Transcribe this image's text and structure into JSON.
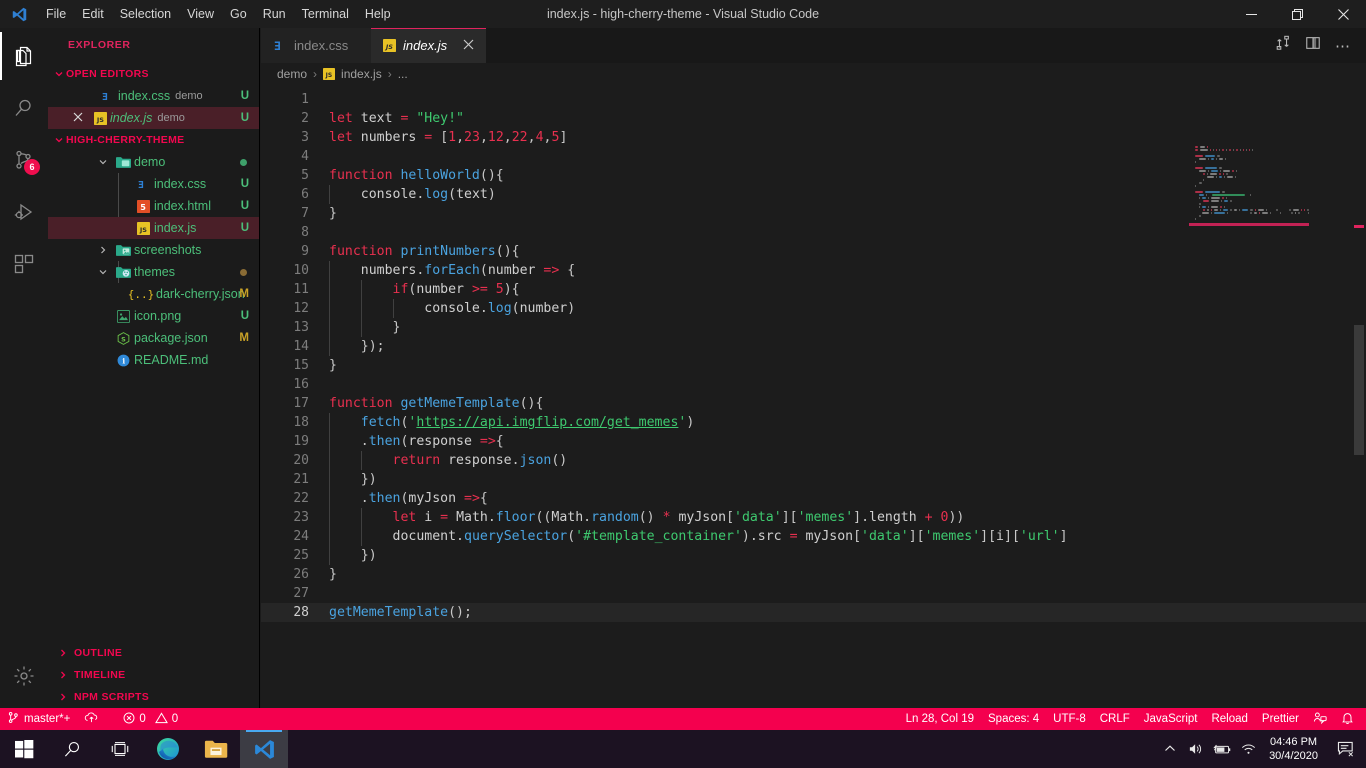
{
  "window": {
    "title": "index.js - high-cherry-theme - Visual Studio Code",
    "minimize_label": "Minimize",
    "maximize_label": "Restore",
    "close_label": "Close"
  },
  "menu": [
    "File",
    "Edit",
    "Selection",
    "View",
    "Go",
    "Run",
    "Terminal",
    "Help"
  ],
  "activitybar": {
    "items": [
      {
        "name": "explorer",
        "icon": "files-icon",
        "active": true,
        "badge": ""
      },
      {
        "name": "search",
        "icon": "search-icon",
        "active": false,
        "badge": ""
      },
      {
        "name": "source-control",
        "icon": "source-control-icon",
        "active": false,
        "badge": "6"
      },
      {
        "name": "run-debug",
        "icon": "run-debug-icon",
        "active": false,
        "badge": ""
      },
      {
        "name": "extensions",
        "icon": "extensions-icon",
        "active": false,
        "badge": ""
      }
    ],
    "settings_icon": "gear-icon"
  },
  "sidebar": {
    "title": "EXPLORER",
    "open_editors": {
      "label": "OPEN EDITORS",
      "items": [
        {
          "name": "index.css",
          "sub": "demo",
          "status": "U",
          "icon": "css-icon",
          "selected": false,
          "closable": false,
          "italic": false
        },
        {
          "name": "index.js",
          "sub": "demo",
          "status": "U",
          "icon": "js-icon",
          "selected": true,
          "closable": true,
          "italic": true
        }
      ]
    },
    "project": {
      "label": "HIGH-CHERRY-THEME",
      "items": [
        {
          "name": "demo",
          "type": "folder",
          "expanded": true,
          "depth": 1,
          "icon": "folder-demo-icon",
          "status": "",
          "dot": "#3ea06a",
          "selected": false
        },
        {
          "name": "index.css",
          "type": "file",
          "depth": 2,
          "icon": "css-icon",
          "status": "U",
          "selected": false
        },
        {
          "name": "index.html",
          "type": "file",
          "depth": 2,
          "icon": "html-icon",
          "status": "U",
          "selected": false
        },
        {
          "name": "index.js",
          "type": "file",
          "depth": 2,
          "icon": "js-icon",
          "status": "U",
          "selected": true
        },
        {
          "name": "screenshots",
          "type": "folder",
          "expanded": false,
          "depth": 1,
          "icon": "folder-images-icon",
          "status": "",
          "selected": false
        },
        {
          "name": "themes",
          "type": "folder",
          "expanded": true,
          "depth": 1,
          "icon": "folder-theme-icon",
          "status": "",
          "dot": "#9a7b3f",
          "selected": false
        },
        {
          "name": "dark-cherry.json",
          "type": "file",
          "depth": 2,
          "icon": "json-icon",
          "status": "M",
          "selected": false
        },
        {
          "name": "icon.png",
          "type": "file",
          "depth": 1,
          "icon": "image-icon",
          "status": "U",
          "selected": false
        },
        {
          "name": "package.json",
          "type": "file",
          "depth": 1,
          "icon": "nodejs-icon",
          "status": "M",
          "selected": false
        },
        {
          "name": "README.md",
          "type": "file",
          "depth": 1,
          "icon": "info-icon",
          "status": "",
          "selected": false
        }
      ]
    },
    "bottom_sections": [
      "OUTLINE",
      "TIMELINE",
      "NPM SCRIPTS"
    ]
  },
  "editor": {
    "tabs": [
      {
        "label": "index.css",
        "icon": "css-icon",
        "active": false,
        "closable": false
      },
      {
        "label": "index.js",
        "icon": "js-icon",
        "active": true,
        "closable": true
      }
    ],
    "tab_actions": [
      "split-editor-icon",
      "more-actions-icon"
    ],
    "title_actions": [
      "compare-changes-icon"
    ],
    "breadcrumb": [
      "demo",
      "index.js",
      "..."
    ],
    "breadcrumb_icon": "js-icon",
    "current_line": 28,
    "lines": [
      {
        "n": 1,
        "tokens": []
      },
      {
        "n": 2,
        "tokens": [
          [
            "kw",
            "let"
          ],
          [
            "var",
            " text "
          ],
          [
            "op",
            "="
          ],
          [
            "str",
            " \"Hey!\""
          ]
        ]
      },
      {
        "n": 3,
        "tokens": [
          [
            "kw",
            "let"
          ],
          [
            "var",
            " numbers "
          ],
          [
            "op",
            "="
          ],
          [
            "punc",
            " ["
          ],
          [
            "num",
            "1"
          ],
          [
            "punc",
            ","
          ],
          [
            "num",
            "23"
          ],
          [
            "punc",
            ","
          ],
          [
            "num",
            "12"
          ],
          [
            "punc",
            ","
          ],
          [
            "num",
            "22"
          ],
          [
            "punc",
            ","
          ],
          [
            "num",
            "4"
          ],
          [
            "punc",
            ","
          ],
          [
            "num",
            "5"
          ],
          [
            "punc",
            "]"
          ]
        ]
      },
      {
        "n": 4,
        "tokens": []
      },
      {
        "n": 5,
        "tokens": [
          [
            "kw",
            "function"
          ],
          [
            "fn",
            " helloWorld"
          ],
          [
            "punc",
            "(){"
          ]
        ]
      },
      {
        "n": 6,
        "tokens": [
          [
            "var",
            "    console"
          ],
          [
            "punc",
            "."
          ],
          [
            "fn",
            "log"
          ],
          [
            "punc",
            "("
          ],
          [
            "var",
            "text"
          ],
          [
            "punc",
            ")"
          ]
        ]
      },
      {
        "n": 7,
        "tokens": [
          [
            "punc",
            "}"
          ]
        ]
      },
      {
        "n": 8,
        "tokens": []
      },
      {
        "n": 9,
        "tokens": [
          [
            "kw",
            "function"
          ],
          [
            "fn",
            " printNumbers"
          ],
          [
            "punc",
            "(){"
          ]
        ]
      },
      {
        "n": 10,
        "tokens": [
          [
            "var",
            "    numbers"
          ],
          [
            "punc",
            "."
          ],
          [
            "fn",
            "forEach"
          ],
          [
            "punc",
            "("
          ],
          [
            "var",
            "number "
          ],
          [
            "op",
            "=>"
          ],
          [
            "punc",
            " {"
          ]
        ]
      },
      {
        "n": 11,
        "tokens": [
          [
            "kw",
            "        if"
          ],
          [
            "punc",
            "("
          ],
          [
            "var",
            "number "
          ],
          [
            "op",
            ">="
          ],
          [
            "num",
            " 5"
          ],
          [
            "punc",
            "){"
          ]
        ]
      },
      {
        "n": 12,
        "tokens": [
          [
            "var",
            "            console"
          ],
          [
            "punc",
            "."
          ],
          [
            "fn",
            "log"
          ],
          [
            "punc",
            "("
          ],
          [
            "var",
            "number"
          ],
          [
            "punc",
            ")"
          ]
        ]
      },
      {
        "n": 13,
        "tokens": [
          [
            "punc",
            "        }"
          ]
        ]
      },
      {
        "n": 14,
        "tokens": [
          [
            "punc",
            "    });"
          ]
        ]
      },
      {
        "n": 15,
        "tokens": [
          [
            "punc",
            "}"
          ]
        ]
      },
      {
        "n": 16,
        "tokens": []
      },
      {
        "n": 17,
        "tokens": [
          [
            "kw",
            "function"
          ],
          [
            "fn",
            " getMemeTemplate"
          ],
          [
            "punc",
            "(){"
          ]
        ]
      },
      {
        "n": 18,
        "tokens": [
          [
            "fn",
            "    fetch"
          ],
          [
            "punc",
            "("
          ],
          [
            "str",
            "'"
          ],
          [
            "link",
            "https://api.imgflip.com/get_memes"
          ],
          [
            "str",
            "'"
          ],
          [
            "punc",
            ")"
          ]
        ]
      },
      {
        "n": 19,
        "tokens": [
          [
            "punc",
            "    ."
          ],
          [
            "fn",
            "then"
          ],
          [
            "punc",
            "("
          ],
          [
            "var",
            "response "
          ],
          [
            "op",
            "=>"
          ],
          [
            "punc",
            "{"
          ]
        ]
      },
      {
        "n": 20,
        "tokens": [
          [
            "kw",
            "        return"
          ],
          [
            "var",
            " response"
          ],
          [
            "punc",
            "."
          ],
          [
            "fn",
            "json"
          ],
          [
            "punc",
            "()"
          ]
        ]
      },
      {
        "n": 21,
        "tokens": [
          [
            "punc",
            "    })"
          ]
        ]
      },
      {
        "n": 22,
        "tokens": [
          [
            "punc",
            "    ."
          ],
          [
            "fn",
            "then"
          ],
          [
            "punc",
            "("
          ],
          [
            "var",
            "myJson "
          ],
          [
            "op",
            "=>"
          ],
          [
            "punc",
            "{"
          ]
        ]
      },
      {
        "n": 23,
        "tokens": [
          [
            "kw",
            "        let"
          ],
          [
            "var",
            " i "
          ],
          [
            "op",
            "="
          ],
          [
            "var",
            " Math"
          ],
          [
            "punc",
            "."
          ],
          [
            "fn",
            "floor"
          ],
          [
            "punc",
            "(("
          ],
          [
            "var",
            "Math"
          ],
          [
            "punc",
            "."
          ],
          [
            "fn",
            "random"
          ],
          [
            "punc",
            "() "
          ],
          [
            "op",
            "*"
          ],
          [
            "var",
            " myJson"
          ],
          [
            "punc",
            "["
          ],
          [
            "str",
            "'data'"
          ],
          [
            "punc",
            "]["
          ],
          [
            "str",
            "'memes'"
          ],
          [
            "punc",
            "]."
          ],
          [
            "var",
            "length "
          ],
          [
            "op",
            "+"
          ],
          [
            "num",
            " 0"
          ],
          [
            "punc",
            "))"
          ]
        ]
      },
      {
        "n": 24,
        "tokens": [
          [
            "var",
            "        document"
          ],
          [
            "punc",
            "."
          ],
          [
            "fn",
            "querySelector"
          ],
          [
            "punc",
            "("
          ],
          [
            "str",
            "'#template_container'"
          ],
          [
            "punc",
            ")."
          ],
          [
            "var",
            "src "
          ],
          [
            "op",
            "="
          ],
          [
            "var",
            " myJson"
          ],
          [
            "punc",
            "["
          ],
          [
            "str",
            "'data'"
          ],
          [
            "punc",
            "]["
          ],
          [
            "str",
            "'memes'"
          ],
          [
            "punc",
            "]["
          ],
          [
            "var",
            "i"
          ],
          [
            "punc",
            "]["
          ],
          [
            "str",
            "'url'"
          ],
          [
            "punc",
            "]"
          ]
        ]
      },
      {
        "n": 25,
        "tokens": [
          [
            "punc",
            "    })"
          ]
        ]
      },
      {
        "n": 26,
        "tokens": [
          [
            "punc",
            "}"
          ]
        ]
      },
      {
        "n": 27,
        "tokens": []
      },
      {
        "n": 28,
        "tokens": [
          [
            "fn",
            "getMemeTemplate"
          ],
          [
            "punc",
            "();"
          ]
        ]
      }
    ]
  },
  "statusbar": {
    "branch": "master*+",
    "branch_icon": "source-control-icon",
    "sync_icon": "sync-cloud-icon",
    "errors": "0",
    "warnings": "0",
    "error_icon": "error-icon",
    "warning_icon": "warning-icon",
    "right_items": [
      "Ln 28, Col 19",
      "Spaces: 4",
      "UTF-8",
      "CRLF",
      "JavaScript",
      "Reload",
      "Prettier"
    ],
    "right_icons": [
      "live-share-icon",
      "bell-icon"
    ],
    "color": "#f4004e"
  },
  "taskbar": {
    "items": [
      {
        "name": "start-button",
        "icon": "windows-icon",
        "active": false
      },
      {
        "name": "search",
        "icon": "search-icon",
        "active": false
      },
      {
        "name": "task-view",
        "icon": "task-view-icon",
        "active": false
      },
      {
        "name": "edge",
        "icon": "edge-icon",
        "active": false
      },
      {
        "name": "file-explorer",
        "icon": "folder-icon",
        "active": false
      },
      {
        "name": "vscode",
        "icon": "vscode-icon",
        "active": true
      }
    ],
    "tray_icons": [
      "show-hidden-icon",
      "volume-icon",
      "battery-icon",
      "wifi-icon"
    ],
    "clock": {
      "time": "04:46 PM",
      "date": "30/4/2020"
    },
    "notification_icon": "action-center-icon"
  }
}
